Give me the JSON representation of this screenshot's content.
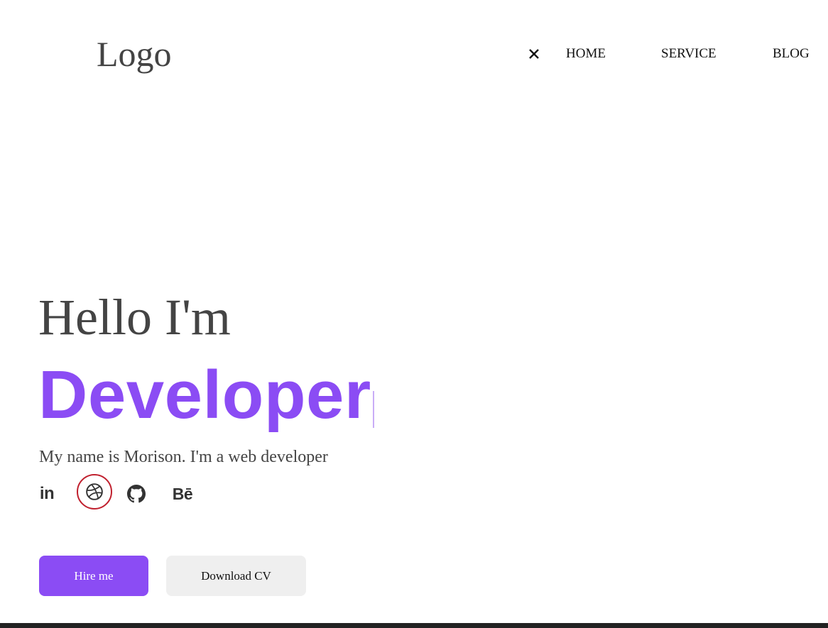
{
  "header": {
    "logo": "Logo",
    "close_icon": "close-icon",
    "nav": {
      "home": "HOME",
      "service": "SERVICE",
      "blog": "BLOG"
    }
  },
  "hero": {
    "greeting": "Hello I'm",
    "role": "Developer",
    "tagline": "My name is Morison. I'm a web developer"
  },
  "socials": [
    {
      "icon": "linkedin-icon",
      "text": "in"
    },
    {
      "icon": "dribbble-icon"
    },
    {
      "icon": "github-icon"
    },
    {
      "icon": "behance-icon",
      "text": "Bē"
    }
  ],
  "buttons": {
    "hire": "Hire me",
    "download_cv": "Download CV"
  },
  "colors": {
    "accent": "#8b4cf4",
    "text": "#444444",
    "secondary_button": "#efefef",
    "focus_ring": "#c0202e",
    "footer_bar": "#222222"
  }
}
